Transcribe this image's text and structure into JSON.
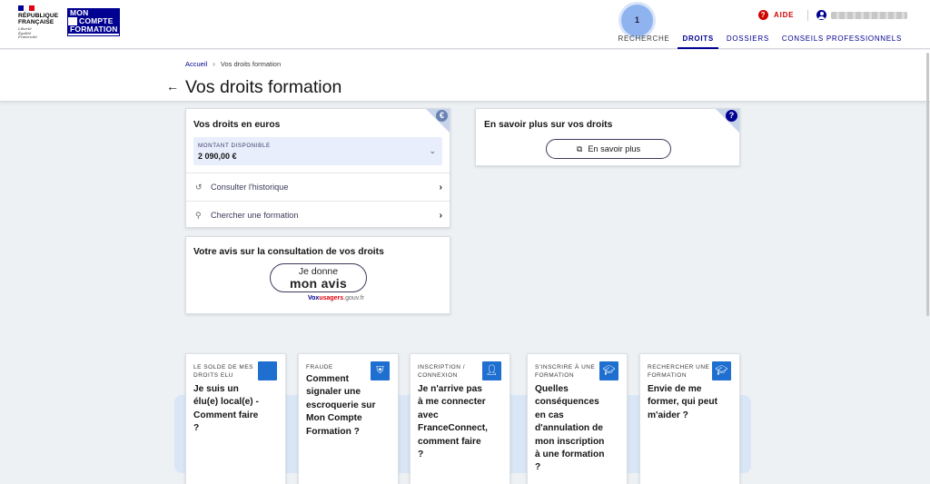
{
  "header": {
    "logo_marianne_lines": [
      "RÉPUBLIQUE",
      "FRANÇAISE"
    ],
    "logo_devise": [
      "Liberté",
      "Égalité",
      "Fraternité"
    ],
    "mcf_logo_lines": [
      "MON",
      "COMPTE",
      "FORMATION"
    ],
    "aide_label": "AIDE",
    "nav": [
      "RECHERCHE",
      "DROITS",
      "DOSSIERS",
      "CONSEILS PROFESSIONNELS"
    ],
    "step_badge": "1"
  },
  "breadcrumb": {
    "home": "Accueil",
    "current": "Vos droits formation"
  },
  "page_title": "Vos droits formation",
  "droits_card": {
    "title": "Vos droits en euros",
    "corner_icon": "€",
    "montant_label": "MONTANT DISPONIBLE",
    "montant_value": "2 090,00 €",
    "rows": [
      {
        "label": "Consulter l'historique",
        "icon": "history-icon"
      },
      {
        "label": "Chercher une formation",
        "icon": "search-icon"
      }
    ]
  },
  "savoir_card": {
    "title": "En savoir plus sur vos droits",
    "corner_icon": "?",
    "button_label": "En savoir plus"
  },
  "avis_card": {
    "title": "Votre avis sur la consultation de vos droits",
    "button_line1": "Je donne",
    "button_line2": "mon avis",
    "vox_brand": "Vox",
    "vox_usagers": "usagers",
    "vox_domain": ".gouv.fr"
  },
  "faq_cards": [
    {
      "category": "LE SOLDE DE MES DROITS ELU",
      "question": "Je suis un élu(e) local(e) - Comment faire ?",
      "icon": "square-icon"
    },
    {
      "category": "FRAUDE",
      "question": "Comment signaler une escroquerie sur Mon Compte Formation ?",
      "icon": "shield-icon"
    },
    {
      "category": "INSCRIPTION / CONNEXION",
      "question": "Je n'arrive pas à me connecter avec FranceConnect, comment faire ?",
      "icon": "user-icon"
    },
    {
      "category": "S'INSCRIRE À UNE FORMATION",
      "question": "Quelles conséquences en cas d'annulation de mon inscription à une formation ?",
      "icon": "graduation-cap-icon"
    },
    {
      "category": "RECHERCHER UNE FORMATION",
      "question": "Envie de me former, qui peut m'aider ?",
      "icon": "graduation-cap-icon"
    }
  ],
  "colors": {
    "primary": "#000091",
    "accent_red": "#ce0500",
    "badge_blue": "#1e6fd0",
    "band": "#d9e6f6"
  }
}
